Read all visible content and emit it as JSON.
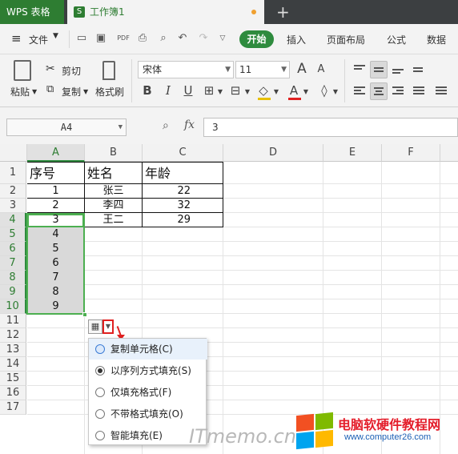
{
  "titlebar": {
    "app_label": "WPS 表格",
    "doc_tab_label": "工作簿1",
    "new_tab_glyph": "+"
  },
  "menubar": {
    "file_label": "文件",
    "tabs": [
      "开始",
      "插入",
      "页面布局",
      "公式",
      "数据"
    ]
  },
  "ribbon": {
    "paste_label": "粘贴",
    "cut_label": "剪切",
    "copy_label": "复制",
    "format_painter_label": "格式刷",
    "font_name": "宋体",
    "font_size": "11",
    "bold": "B",
    "italic": "I",
    "underline": "U",
    "grow_font": "A",
    "shrink_font": "A",
    "font_color_glyph": "A"
  },
  "formula_bar": {
    "name_box": "A4",
    "fx_label": "fx",
    "formula_value": "3"
  },
  "columns": [
    "A",
    "B",
    "C",
    "D",
    "E",
    "F"
  ],
  "rows": [
    "1",
    "2",
    "3",
    "4",
    "5",
    "6",
    "7",
    "8",
    "9",
    "10",
    "11",
    "12",
    "13",
    "14",
    "15",
    "16",
    "17"
  ],
  "sheet": {
    "headers": [
      "序号",
      "姓名",
      "年龄"
    ],
    "records": [
      {
        "no": "1",
        "name": "张三",
        "age": "22"
      },
      {
        "no": "2",
        "name": "李四",
        "age": "32"
      },
      {
        "no": "3",
        "name": "王二",
        "age": "29"
      }
    ],
    "filled": [
      "4",
      "5",
      "6",
      "7",
      "8",
      "9"
    ]
  },
  "autofill_menu": {
    "options": [
      {
        "label": "复制单元格(C)",
        "selected": false
      },
      {
        "label": "以序列方式填充(S)",
        "selected": true
      },
      {
        "label": "仅填充格式(F)",
        "selected": false
      },
      {
        "label": "不带格式填充(O)",
        "selected": false
      },
      {
        "label": "智能填充(E)",
        "selected": false
      }
    ]
  },
  "watermarks": {
    "itmemo": "ITmemo.cn",
    "site_name": "电脑软硬件教程网",
    "site_url": "www.computer26.com"
  },
  "colors": {
    "accent": "#2e8b3e",
    "selection": "#4caf50",
    "callout": "#e02020"
  }
}
